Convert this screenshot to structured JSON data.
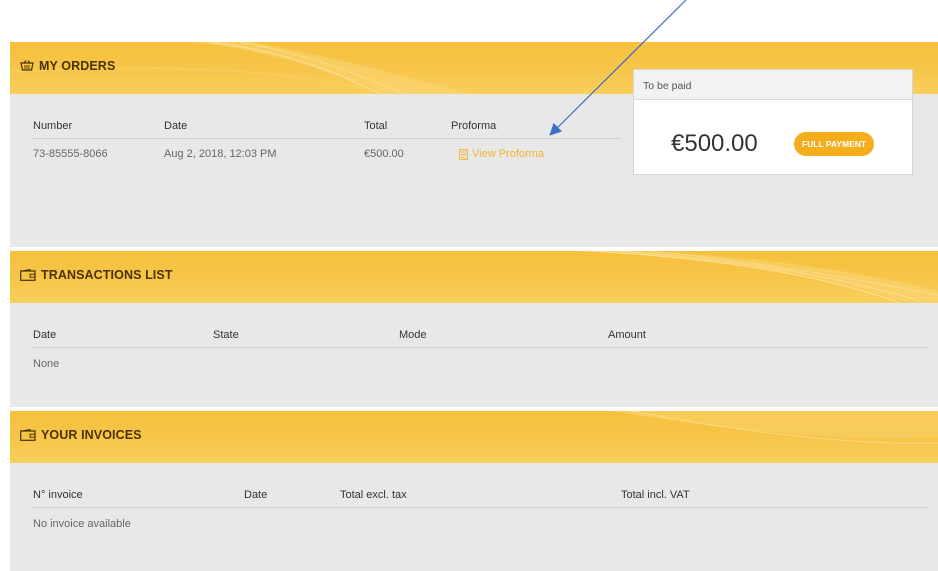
{
  "orders": {
    "title": "MY ORDERS",
    "columns": [
      "Number",
      "Date",
      "Total",
      "Proforma"
    ],
    "rows": [
      {
        "number": "73-85555-8066",
        "date": "Aug 2, 2018, 12:03 PM",
        "total": "€500.00",
        "proforma": "View Proforma"
      }
    ],
    "payment": {
      "header": "To be paid",
      "amount": "€500.00",
      "badge": "FULL PAYMENT"
    }
  },
  "transactions": {
    "title": "TRANSACTIONS LIST",
    "columns": [
      "Date",
      "State",
      "Mode",
      "Amount"
    ],
    "empty_text": "None"
  },
  "invoices": {
    "title": "YOUR INVOICES",
    "columns": [
      "N° invoice",
      "Date",
      "Total excl. tax",
      "Total incl. VAT"
    ],
    "empty_text": "No invoice available"
  },
  "colors": {
    "banner": "#f7c03d",
    "accent": "#f3ad1d",
    "link": "#f0b533",
    "panel": "#e8e8e8",
    "annotation_arrow": "#3d6fc8"
  },
  "icons": {
    "orders": "basket-icon",
    "transactions": "wallet-icon",
    "invoices": "wallet-icon",
    "proforma": "document-icon"
  }
}
